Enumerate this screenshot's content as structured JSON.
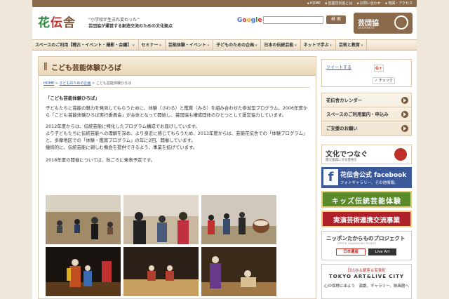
{
  "top_links": [
    "HOME",
    "芸能花伝舎とは",
    "お問い合わせ",
    "地図・アクセス"
  ],
  "logo": {
    "flower": "花",
    "den": "伝",
    "sha": "舎"
  },
  "tagline": {
    "line1": "“小学校が生まれ変わった”",
    "line2": "芸団協が運営する創造交流のための文化拠点"
  },
  "search": {
    "value": "",
    "button": "検 索"
  },
  "geidankyo": {
    "title": "芸団協",
    "sub": "GEIDANKYO"
  },
  "nav": [
    "スペースのご利用【稽古・イベント・撮影・会議】",
    "セミナー",
    "芸能体験・イベント",
    "子どものための企画",
    "日本の伝統芸能",
    "ネットで学ぶ",
    "芸術と教育"
  ],
  "main": {
    "title": "こども芸能体験ひろば",
    "breadcrumb": {
      "home": "HOME",
      "sep1": " > ",
      "parent": "子どものための企画",
      "sep2": " > ",
      "current": "こども芸能体験ひろば"
    },
    "heading": "「こども芸能体験ひろば」",
    "paragraphs": [
      "子どもたちに芸能の魅力を発見してもらうために、体験（さわる）と鑑賞（みる）を組み合わせた参加型プログラム。2006年度から「こども芸能体験ひろば実行委員会」が主体となって開始し、芸団協も構成団体のひとつとして運営協力しています。",
      "2012年度からは、伝統芸能に特化したプログラム構成でお届けしています。",
      "より子どもたちに伝統芸能への理解を深め、より身近に感じてもらうため、2013年度からは、芸能花伝舎での「体験プログラム」と、多摩地区での「体験・鑑賞プログラム」の年に2回、開催しています。",
      "継続的に、伝統芸能に親しむ機会を提供できるよう、事業を拡げています。",
      "2018年度の開催については、秋ごろに発表予定です。"
    ]
  },
  "sidebar": {
    "tweet": "ツイートする",
    "gplus": "G+",
    "check": "✓ チェック",
    "menu": [
      "花伝舎カレンダー",
      "スペースのご利用案内・申込み",
      "ご支援のお願い"
    ],
    "bunka": {
      "title": "文化でつなぐ",
      "sub": "震災復興に文化芸術を"
    },
    "facebook": {
      "title": "花伝舎公式 facebook",
      "sub": "フォトギャラリー、その他情報。"
    },
    "kids": "キッズ伝統芸能体験",
    "jitsuen": "実演芸術連携交流事業",
    "nippon": {
      "title": "ニッポンたからものプロジェクト",
      "sub": "NIPPON TAKARAMONO PROJECT",
      "b1": "日本遺産",
      "b2": "Live Art"
    },
    "tokyo": {
      "l1": "日比谷＆銀座＆有楽町",
      "l2": "TOKYO ART&LIVE CITY",
      "l3": "心の探検に出よう　演劇、ギャラリー、映画館へ"
    }
  }
}
